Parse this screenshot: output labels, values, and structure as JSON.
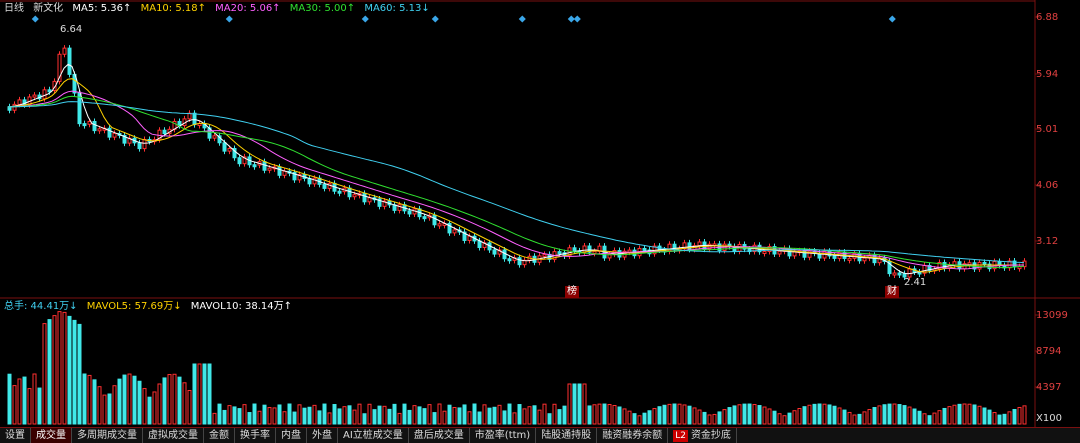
{
  "legend_top": {
    "period": "日线",
    "stock": "新文化",
    "ma5": {
      "label": "MA5: 5.36↑",
      "color": "#ffffff"
    },
    "ma10": {
      "label": "MA10: 5.18↑",
      "color": "#ffd200"
    },
    "ma20": {
      "label": "MA20: 5.06↑",
      "color": "#ff60ff"
    },
    "ma30": {
      "label": "MA30: 5.00↑",
      "color": "#30e030"
    },
    "ma60": {
      "label": "MA60: 5.13↓",
      "color": "#40d0f0"
    }
  },
  "legend_bottom": {
    "total": {
      "label": "总手: 44.41万↓",
      "color": "#40d0f0"
    },
    "mavol5": {
      "label": "MAVOL5: 57.69万↓",
      "color": "#ffd200"
    },
    "mavol10": {
      "label": "MAVOL10: 38.14万↑",
      "color": "#ffffff"
    }
  },
  "price_axis": [
    "6.88",
    "5.94",
    "5.01",
    "4.06",
    "3.12"
  ],
  "volume_axis": [
    "13099",
    "8794",
    "4397",
    "X100"
  ],
  "annotations": {
    "high": "6.64",
    "low": "2.41",
    "mark1": "榜",
    "mark2": "财"
  },
  "tabs": [
    {
      "label": "设置",
      "active": false
    },
    {
      "label": "成交量",
      "active": true
    },
    {
      "label": "多周期成交量",
      "active": false
    },
    {
      "label": "虚拟成交量",
      "active": false
    },
    {
      "label": "金额",
      "active": false
    },
    {
      "label": "换手率",
      "active": false
    },
    {
      "label": "内盘",
      "active": false
    },
    {
      "label": "外盘",
      "active": false
    },
    {
      "label": "AI立桩成交量",
      "active": false
    },
    {
      "label": "盘后成交量",
      "active": false
    },
    {
      "label": "市盈率(ttm)",
      "active": false
    },
    {
      "label": "陆股通持股",
      "active": false
    },
    {
      "label": "融资融券余额",
      "active": false
    },
    {
      "label": "资金抄底",
      "active": false,
      "badge": "L2"
    }
  ],
  "colors": {
    "up": "#ff3030",
    "down": "#40e8e8",
    "axis": "#7a1010"
  }
}
